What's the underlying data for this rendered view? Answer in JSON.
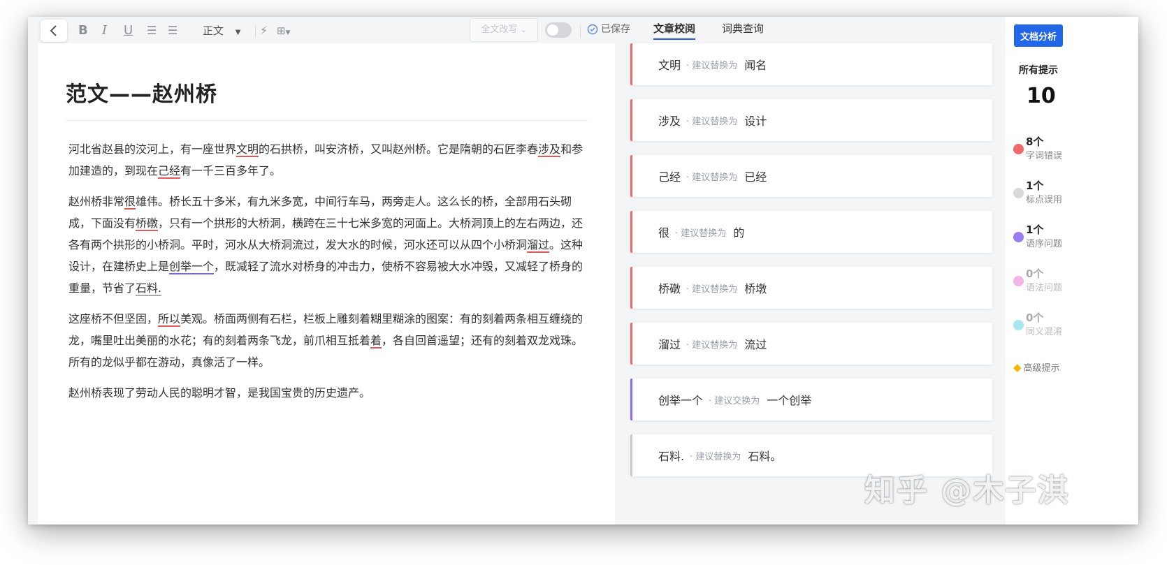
{
  "toolbar": {
    "style_select": "正文",
    "rewrite_label": "全文改写",
    "saved_label": "已保存"
  },
  "document": {
    "title": "范文——赵州桥",
    "paragraphs": [
      [
        {
          "t": "河北省赵县的洨河上，有一座世界"
        },
        {
          "t": "文明",
          "m": "red"
        },
        {
          "t": "的石拱桥，叫安济桥，又叫赵州桥。它是隋朝的石匠李春"
        },
        {
          "t": "涉及",
          "m": "red"
        },
        {
          "t": "和参加建造的，到现在"
        },
        {
          "t": "己经",
          "m": "red"
        },
        {
          "t": "有一千三百多年了。"
        }
      ],
      [
        {
          "t": "赵州桥非常"
        },
        {
          "t": "很",
          "m": "red"
        },
        {
          "t": "雄伟。桥长五十多米，有九米多宽，中间行车马，两旁走人。这么长的桥，全部用石头砌成，下面没有"
        },
        {
          "t": "桥礅",
          "m": "red"
        },
        {
          "t": "，只有一个拱形的大桥洞，横跨在三十七米多宽的河面上。大桥洞顶上的左右两边，还各有两个拱形的小桥洞。平时，河水从大桥洞流过，发大水的时候，河水还可以从四个小桥洞"
        },
        {
          "t": "溜过",
          "m": "red"
        },
        {
          "t": "。这种设计，在建桥史上是"
        },
        {
          "t": "创举一个",
          "m": "purple"
        },
        {
          "t": "，既减轻了流水对桥身的冲击力，使桥不容易被大水冲毁，又减轻了桥身的重量，节省了"
        },
        {
          "t": "石料.",
          "m": "gray"
        }
      ],
      [
        {
          "t": "这座桥不但坚固，"
        },
        {
          "t": "所以",
          "m": "red"
        },
        {
          "t": "美观。桥面两侧有石栏，栏板上雕刻着糊里糊涂的图案：有的刻着两条相互缠绕的龙，嘴里吐出美丽的水花；有的刻着两条飞龙，前爪相互抵着"
        },
        {
          "t": "着",
          "m": "red"
        },
        {
          "t": "，各自回首遥望；还有的刻着双龙戏珠。所有的龙似乎都在游动，真像活了一样。"
        }
      ],
      [
        {
          "t": "赵州桥表现了劳动人民的聪明才智，是我国宝贵的历史遗产。"
        }
      ]
    ]
  },
  "tabs": [
    "文章校阅",
    "词典查询"
  ],
  "suggestions": [
    {
      "orig": "文明",
      "hint": "· 建议替换为",
      "repl": "闻名",
      "color": "red"
    },
    {
      "orig": "涉及",
      "hint": "· 建议替换为",
      "repl": "设计",
      "color": "red"
    },
    {
      "orig": "己经",
      "hint": "· 建议替换为",
      "repl": "已经",
      "color": "red"
    },
    {
      "orig": "很",
      "hint": "· 建议替换为",
      "repl": "的",
      "color": "red"
    },
    {
      "orig": "桥礅",
      "hint": "· 建议替换为",
      "repl": "桥墩",
      "color": "red"
    },
    {
      "orig": "溜过",
      "hint": "· 建议替换为",
      "repl": "流过",
      "color": "red"
    },
    {
      "orig": "创举一个",
      "hint": "· 建议交换为",
      "repl": "一个创举",
      "color": "purple"
    },
    {
      "orig": "石料.",
      "hint": "· 建议替换为",
      "repl": "石料。",
      "color": "gray"
    }
  ],
  "sidebar": {
    "analyze_button": "文档分析",
    "all_label": "所有提示",
    "all_count": "10",
    "stats": [
      {
        "count": "8个",
        "label": "字词错误",
        "color": "#f06a6a",
        "dim": false
      },
      {
        "count": "1个",
        "label": "标点误用",
        "color": "#d9d9d9",
        "dim": false
      },
      {
        "count": "1个",
        "label": "语序问题",
        "color": "#9b7cf5",
        "dim": false
      },
      {
        "count": "0个",
        "label": "语法问题",
        "color": "#f2b6e6",
        "dim": true
      },
      {
        "count": "0个",
        "label": "同义混淆",
        "color": "#a9e6f2",
        "dim": true
      }
    ],
    "premium_label": "高级提示"
  },
  "watermark": "知乎 @木子淇"
}
